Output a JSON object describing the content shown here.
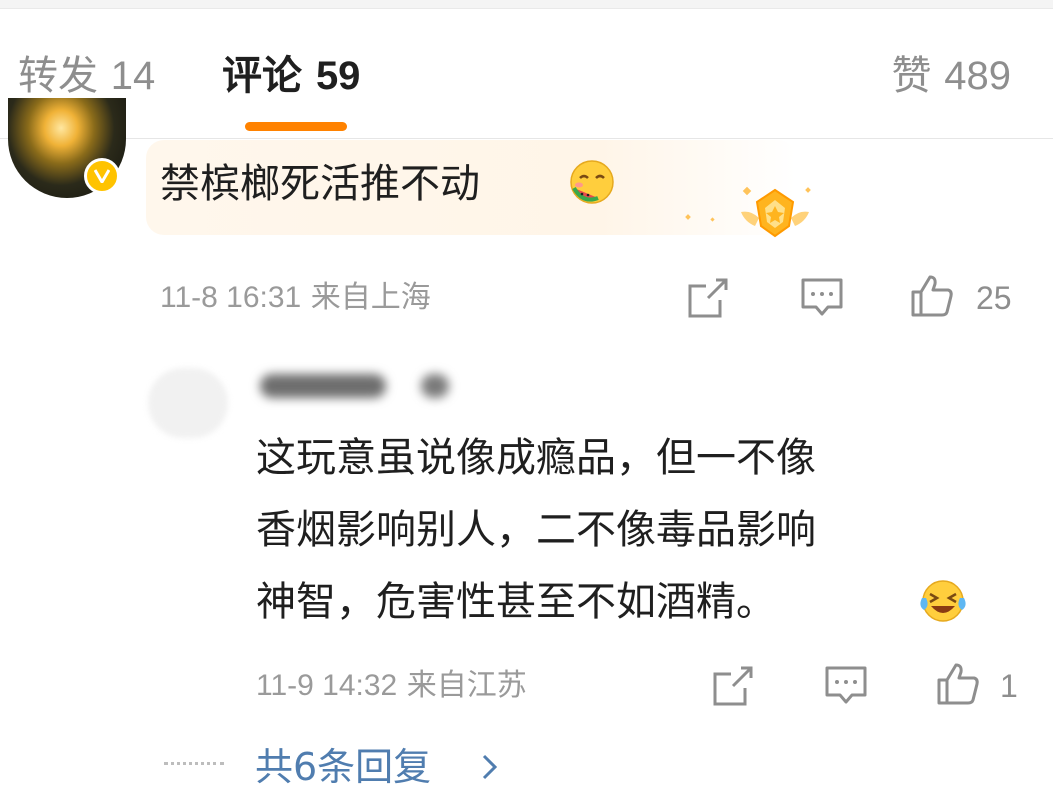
{
  "tabs": {
    "repost": {
      "label": "转发",
      "count": "14"
    },
    "comment": {
      "label": "评论",
      "count": "59"
    },
    "like": {
      "label": "赞",
      "count": "489"
    }
  },
  "accent_color": "#ff8200",
  "link_color": "#507daf",
  "comments": [
    {
      "text": "禁槟榔死活推不动",
      "emoji": "smiling-eating-watermelon-emoji",
      "badge": "medal-icon",
      "date": "11-8 16:31",
      "location": "来自上海",
      "likes": "25"
    },
    {
      "text_lines": [
        "这玩意虽说像成瘾品，但一不像",
        "香烟影响别人，二不像毒品影响",
        "神智，危害性甚至不如酒精。"
      ],
      "emoji": "laughing-tears-emoji",
      "date": "11-9 14:32",
      "location": "来自江苏",
      "likes": "1"
    }
  ],
  "replies_link": "共6条回复"
}
